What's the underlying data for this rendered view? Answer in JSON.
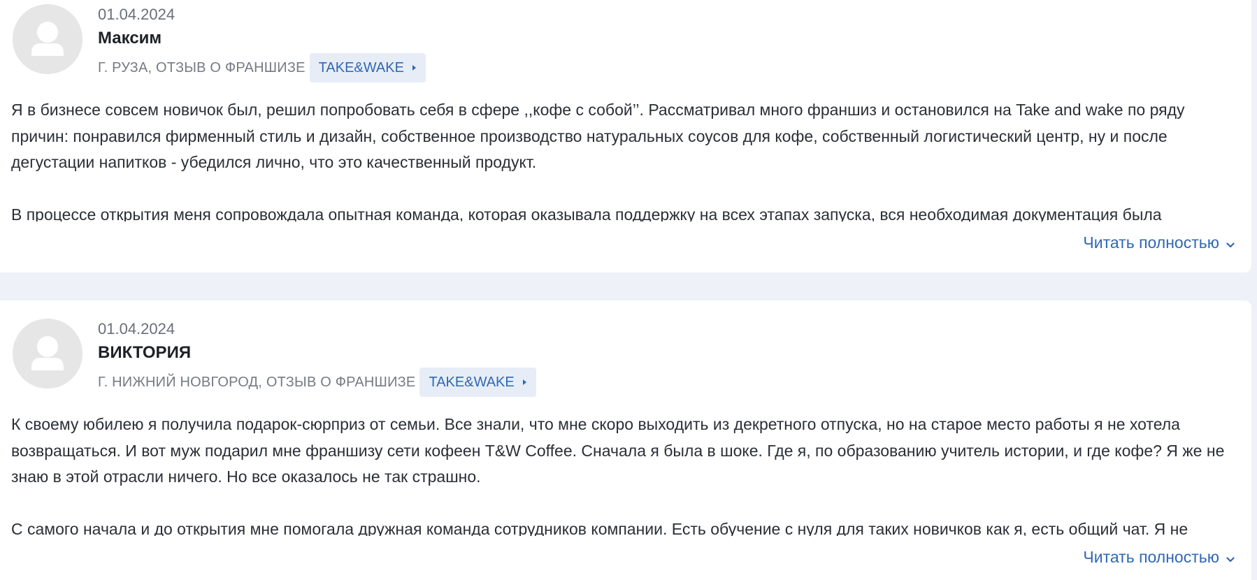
{
  "reviews": [
    {
      "date": "01.04.2024",
      "author": "Максим",
      "location": "г. Руза, Отзыв о франшизе",
      "franchise": "Take&Wake",
      "paragraphs": [
        "Я в бизнесе совсем новичок был,  решил попробовать себя в сфере ,,кофе с собой’’. Рассматривал много франшиз и остановился на Take and wake по ряду причин: понравился фирменный стиль и дизайн, собственное производство натуральных соусов для кофе, собственный логистический центр, ну и после дегустации напитков - убедился лично, что это качественный продукт.",
        "В процессе открытия меня сопровождала опытная команда, которая оказывала поддержку на всех этапах запуска, вся необходимая документация была"
      ],
      "read_more": "Читать полностью"
    },
    {
      "date": "01.04.2024",
      "author": "ВИКТОРИЯ",
      "location": "г. Нижний Новгород, Отзыв о франшизе",
      "franchise": "Take&Wake",
      "paragraphs": [
        "К своему юбилею я получила подарок-сюрприз от семьи. Все знали, что мне скоро выходить из декретного отпуска, но на старое место работы я не хотела возвращаться. И вот муж подарил мне франшизу сети кофеен T&W Coffee. Сначала я была в шоке. Где я, по образованию учитель истории, и где кофе? Я же не знаю в этой отрасли ничего. Но все оказалось не так страшно.",
        "С самого начала и до открытия мне помогала дружная команда сотрудников компании. Есть обучение с нуля для таких новичков как я, есть общий чат. Я не"
      ],
      "read_more": "Читать полностью"
    }
  ],
  "icons": {
    "avatar": "user-silhouette-icon",
    "tag_arrow": "caret-right-icon",
    "read_more": "chevron-down-icon"
  },
  "colors": {
    "accent": "#2f67b5",
    "tag_background": "#e7edf6",
    "avatar_background": "#e6e6e6",
    "page_background": "#eef1f8"
  }
}
